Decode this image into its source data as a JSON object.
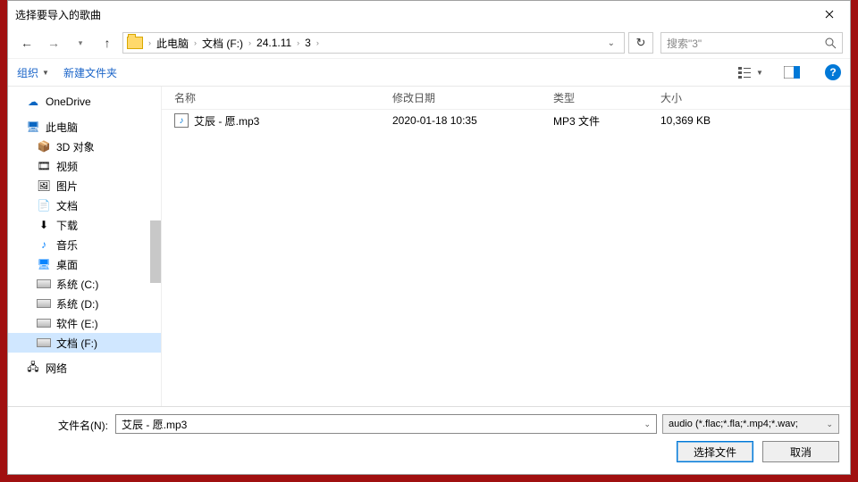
{
  "title": "选择要导入的歌曲",
  "breadcrumbs": [
    "此电脑",
    "文档 (F:)",
    "24.1.11",
    "3"
  ],
  "search_placeholder": "搜索\"3\"",
  "toolbar": {
    "organize": "组织",
    "newfolder": "新建文件夹"
  },
  "tree": {
    "onedrive": "OneDrive",
    "thispc": "此电脑",
    "items": [
      "3D 对象",
      "视频",
      "图片",
      "文档",
      "下载",
      "音乐",
      "桌面",
      "系统 (C:)",
      "系统 (D:)",
      "软件 (E:)",
      "文档 (F:)"
    ],
    "network": "网络"
  },
  "columns": {
    "name": "名称",
    "date": "修改日期",
    "type": "类型",
    "size": "大小"
  },
  "rows": [
    {
      "name": "艾辰 - 愿.mp3",
      "date": "2020-01-18 10:35",
      "type": "MP3 文件",
      "size": "10,369 KB"
    }
  ],
  "footer": {
    "filename_label": "文件名(N):",
    "filename_value": "艾辰 - 愿.mp3",
    "filter": "audio (*.flac;*.fla;*.mp4;*.wav;",
    "open": "选择文件",
    "cancel": "取消"
  }
}
